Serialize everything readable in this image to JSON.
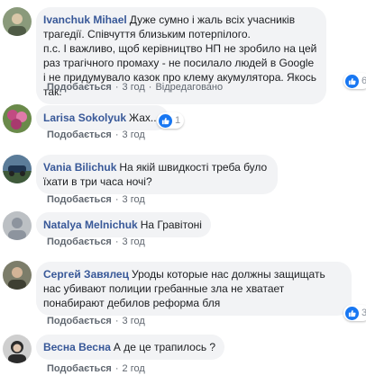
{
  "comments": [
    {
      "author": "Ivanchuk Mihael",
      "text": "Дуже сумно і жаль всіх учасників трагедії. Співчуття близьким потерпілого.\nп.с. І важливо, щоб керівництво НП не зробило на цей раз трагічного промаху - не посилало людей в Google і не придумувало казок про клему акумулятора. Якось так.",
      "like_label": "Подобається",
      "time": "3 год",
      "edited": "Відредаговано",
      "reactions": "6",
      "avatar_color": "#8a9a7b"
    },
    {
      "author": "Larisa Sokolyuk",
      "text": "Жах...",
      "like_label": "Подобається",
      "time": "3 год",
      "reactions": "1",
      "avatar_color": "#b24a7a"
    },
    {
      "author": "Vania Bilichuk",
      "text": "На якій швидкості треба було їхати в три часа ночі?",
      "like_label": "Подобається",
      "time": "3 год",
      "avatar_color": "#4a6a8a"
    },
    {
      "author": "Natalya Melnichuk",
      "text": "На Гравітоні",
      "like_label": "Подобається",
      "time": "3 год",
      "avatar_color": "#9aa0a6"
    },
    {
      "author": "Сергей Завялец",
      "text": "Уроды которые нас должны защищать нас убивают полиции гребанные зла не хватает понабирают дебилов реформа бля",
      "like_label": "Подобається",
      "time": "3 год",
      "reactions": "3",
      "avatar_color": "#6b6e5a"
    },
    {
      "author": "Весна Весна",
      "text": "А де це трапилось ?",
      "like_label": "Подобається",
      "time": "2 год",
      "avatar_color": "#3a3a3a"
    }
  ],
  "colors": {
    "author": "#385898",
    "bubble": "#f2f3f5",
    "meta": "#606770",
    "like_blue": "#1877f2"
  }
}
